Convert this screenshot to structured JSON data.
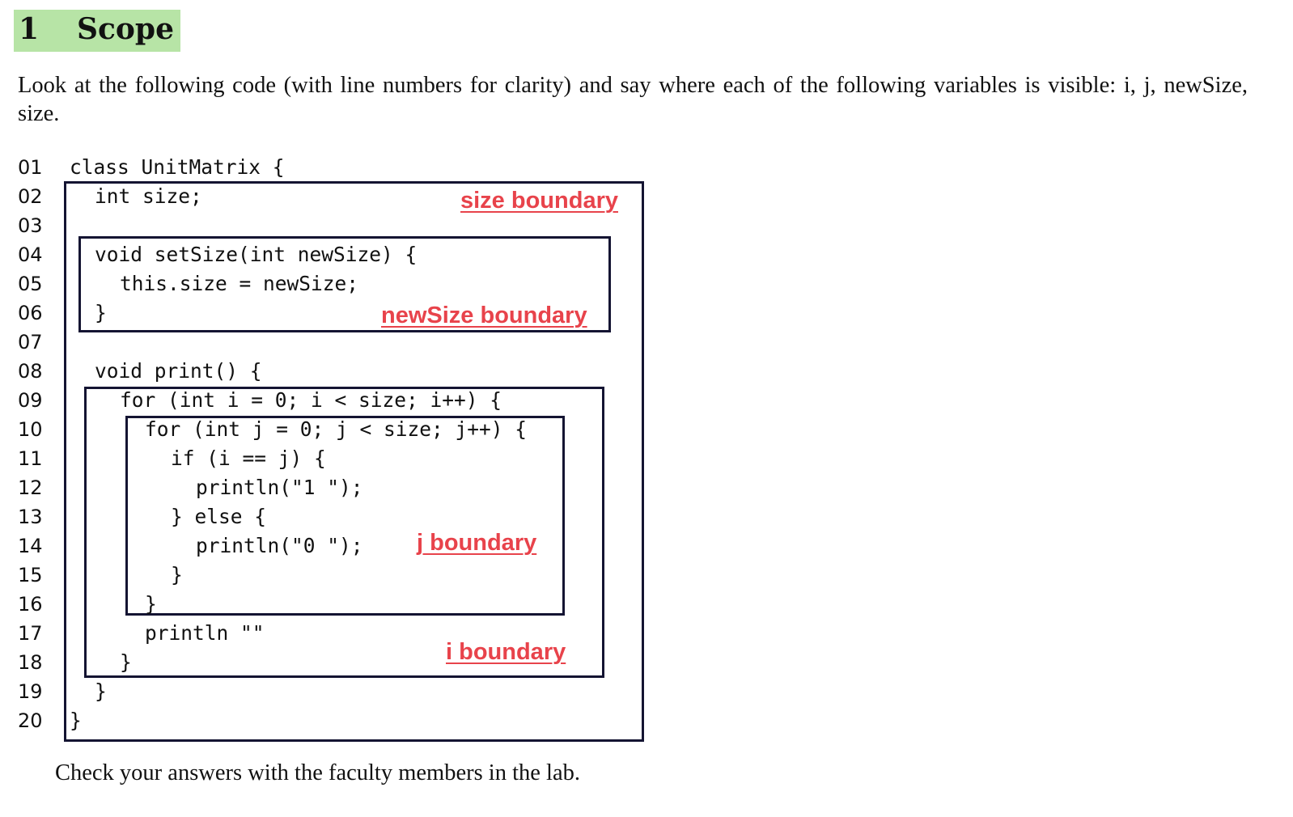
{
  "section": {
    "number": "1",
    "title": "Scope"
  },
  "intro_text": "Look at the following code (with line numbers for clarity) and say where each of the following variables is visible: i, j, newSize, size.",
  "code_lines": [
    {
      "num": "01",
      "text": "class UnitMatrix {"
    },
    {
      "num": "02",
      "text": "int size;"
    },
    {
      "num": "03",
      "text": ""
    },
    {
      "num": "04",
      "text": "void setSize(int newSize) {"
    },
    {
      "num": "05",
      "text": "this.size = newSize;"
    },
    {
      "num": "06",
      "text": "}"
    },
    {
      "num": "07",
      "text": ""
    },
    {
      "num": "08",
      "text": "void print() {"
    },
    {
      "num": "09",
      "text": "for (int i = 0; i < size; i++) {"
    },
    {
      "num": "10",
      "text": "for (int j = 0; j < size; j++) {"
    },
    {
      "num": "11",
      "text": "if (i == j) {"
    },
    {
      "num": "12",
      "text": "println(\"1 \");"
    },
    {
      "num": "13",
      "text": "} else {"
    },
    {
      "num": "14",
      "text": "println(\"0 \");"
    },
    {
      "num": "15",
      "text": "}"
    },
    {
      "num": "16",
      "text": "}"
    },
    {
      "num": "17",
      "text": "println \"\""
    },
    {
      "num": "18",
      "text": "}"
    },
    {
      "num": "19",
      "text": "}"
    },
    {
      "num": "20",
      "text": "}"
    }
  ],
  "boundaries": {
    "size": {
      "label": "size boundary",
      "color": "#e8434b"
    },
    "newSize": {
      "label": "newSize boundary",
      "color": "#e8434b"
    },
    "j": {
      "label": "j boundary",
      "color": "#e8434b"
    },
    "i": {
      "label": "i boundary",
      "color": "#e8434b"
    }
  },
  "box_border_color": "#141432",
  "heading_highlight_color": "#b7e4a6",
  "footer_text": "Check your answers with the faculty members in the lab."
}
